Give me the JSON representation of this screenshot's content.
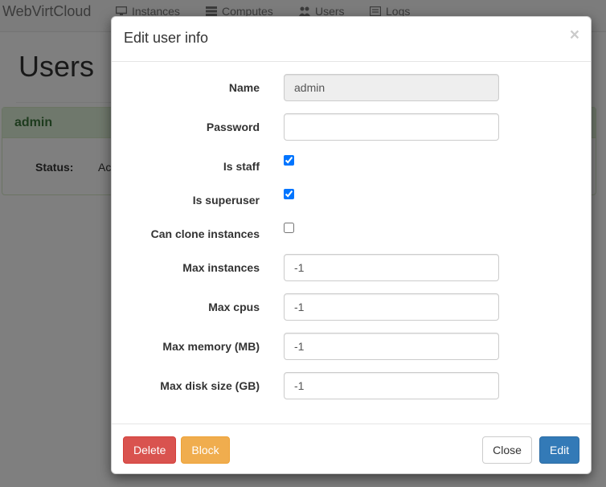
{
  "navbar": {
    "brand": "WebVirtCloud",
    "items": [
      {
        "label": "Instances",
        "icon": "monitor-icon"
      },
      {
        "label": "Computes",
        "icon": "server-list-icon"
      },
      {
        "label": "Users",
        "icon": "users-icon"
      },
      {
        "label": "Logs",
        "icon": "log-list-icon"
      }
    ]
  },
  "page": {
    "title": "Users",
    "panel": {
      "username": "admin",
      "status_label": "Status:",
      "status_value": "Ac"
    }
  },
  "modal": {
    "title": "Edit user info",
    "close_glyph": "×",
    "fields": {
      "name": {
        "label": "Name",
        "value": "admin"
      },
      "password": {
        "label": "Password",
        "value": ""
      },
      "is_staff": {
        "label": "Is staff",
        "checked": true
      },
      "is_superuser": {
        "label": "Is superuser",
        "checked": true
      },
      "can_clone": {
        "label": "Can clone instances",
        "checked": false
      },
      "max_instances": {
        "label": "Max instances",
        "value": "-1"
      },
      "max_cpus": {
        "label": "Max cpus",
        "value": "-1"
      },
      "max_memory": {
        "label": "Max memory (MB)",
        "value": "-1"
      },
      "max_disk": {
        "label": "Max disk size (GB)",
        "value": "-1"
      }
    },
    "buttons": {
      "delete": "Delete",
      "block": "Block",
      "close": "Close",
      "edit": "Edit"
    }
  },
  "colors": {
    "danger": "#d9534f",
    "warning": "#f0ad4e",
    "primary": "#337ab7",
    "success_heading": "#3c763d"
  }
}
